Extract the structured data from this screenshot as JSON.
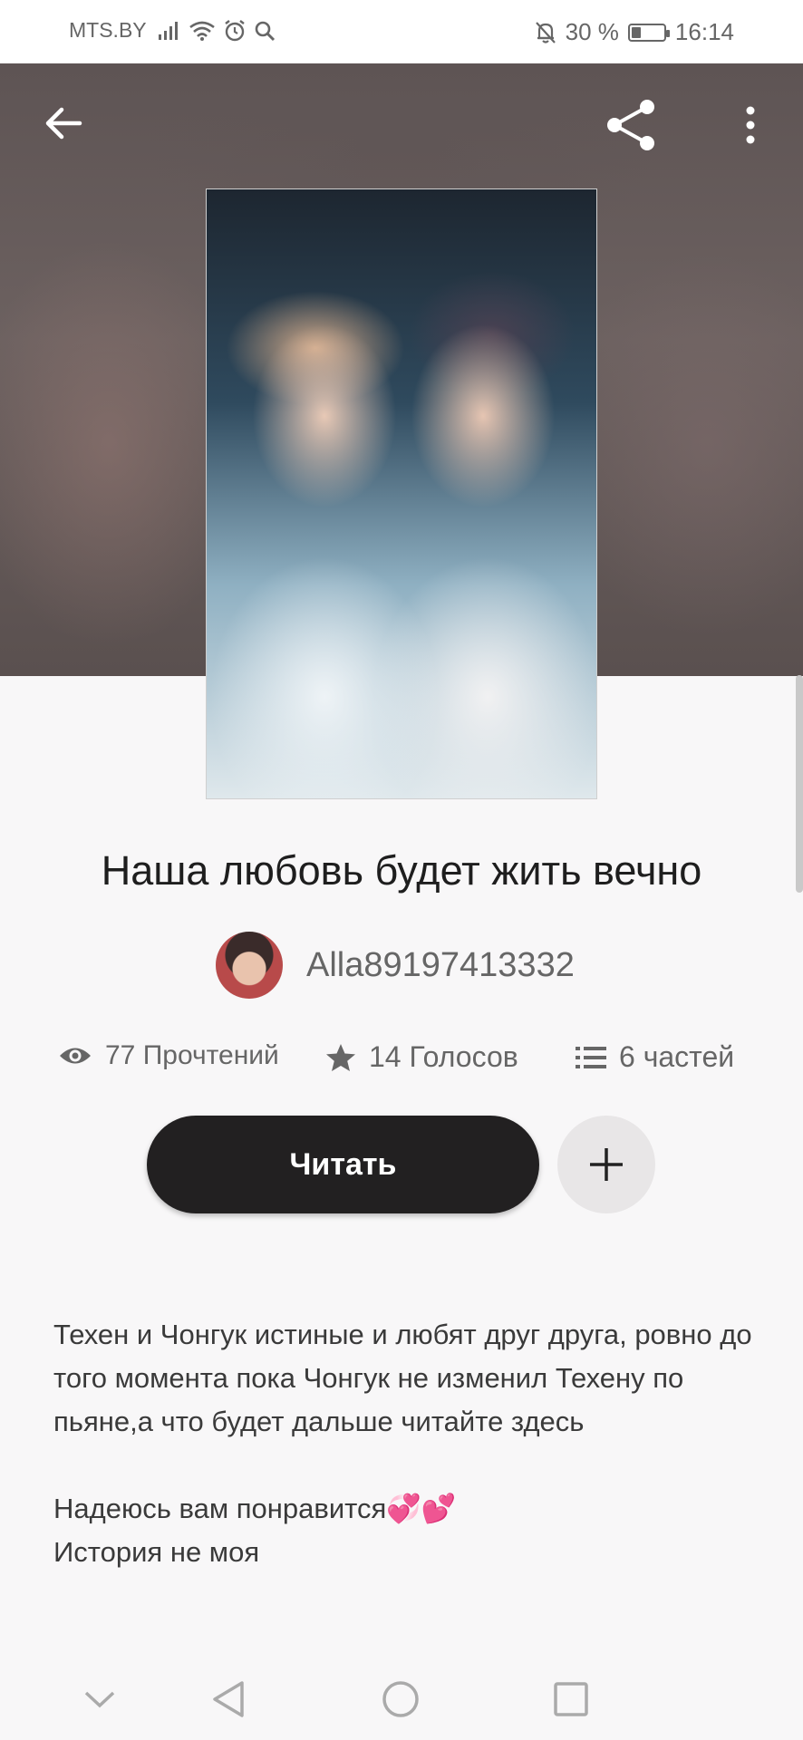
{
  "status_bar": {
    "carrier": "MTS.BY",
    "battery_text": "30 %",
    "battery_level": 0.3,
    "time": "16:14"
  },
  "toolbar": {
    "back_icon": "arrow-left-icon",
    "share_icon": "share-icon",
    "more_icon": "more-vertical-icon"
  },
  "story": {
    "title": "Наша любовь будет жить вечно",
    "author": "Alla89197413332",
    "stats": {
      "reads": "77 Прочтений",
      "votes": "14 Голосов",
      "parts": "6 частей"
    },
    "read_button": "Читать",
    "add_icon": "plus-icon",
    "description": "Техен и Чонгук истиные и любят друг друга, ровно до того момента пока Чонгук не изменил Техену по пьяне,а что будет дальше читайте здесь",
    "note_line1": "Надеюсь вам понравится💞💕",
    "note_line2": "История не моя"
  },
  "nav": {
    "collapse_icon": "chevron-down-icon",
    "back_icon": "triangle-back-icon",
    "home_icon": "circle-home-icon",
    "recents_icon": "square-recents-icon"
  }
}
